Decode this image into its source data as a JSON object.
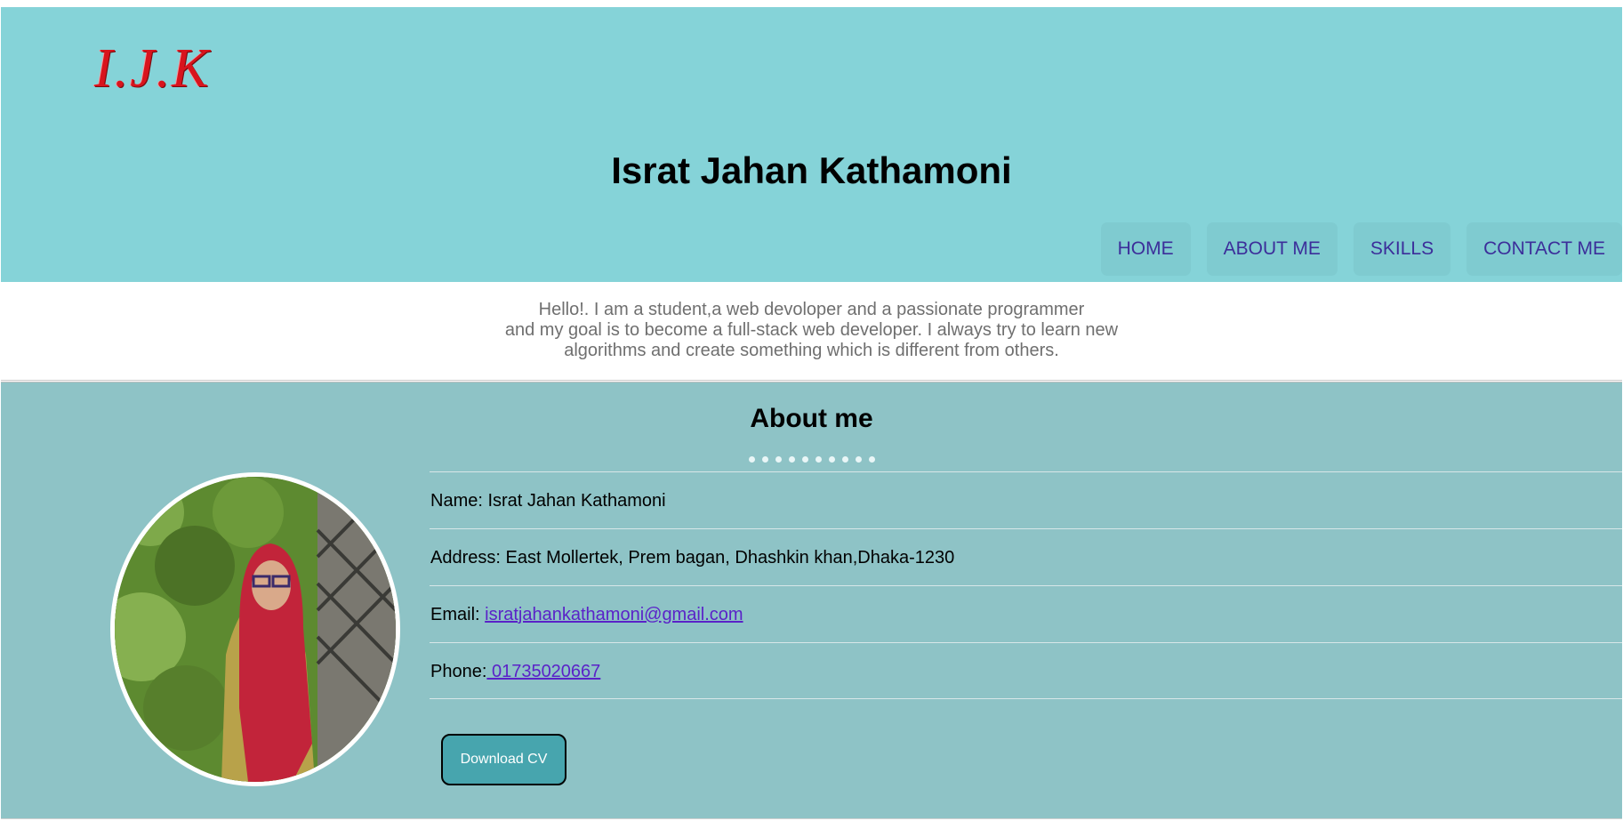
{
  "header": {
    "logo_text": "I.J.K",
    "title": "Israt Jahan Kathamoni",
    "nav": [
      "HOME",
      "ABOUT ME",
      "SKILLS",
      "CONTACT ME"
    ]
  },
  "intro": {
    "lines": [
      "Hello!. I am a student,a web devoloper and a passionate programmer",
      "and my goal is to become a full-stack web developer. I always try to learn new",
      "algorithms and create something which is different from others."
    ]
  },
  "about": {
    "title": "About me",
    "name_label": "Name:",
    "name_value": "Israt Jahan Kathamoni",
    "address_label": "Address:",
    "address_value": "East Mollertek, Prem bagan, Dhashkin khan,Dhaka-1230",
    "email_label": "Email:",
    "email_value": "isratjahankathamoni@gmail.com",
    "phone_label": "Phone:",
    "phone_value": " 01735020667",
    "download_label": "Download CV"
  },
  "colors": {
    "header_bg": "#85d3d8",
    "about_bg": "#8ec3c6",
    "link": "#5a22c8",
    "nav_text": "#3c2e9a",
    "button_bg": "#47a5ae",
    "logo": "#d8141d"
  }
}
